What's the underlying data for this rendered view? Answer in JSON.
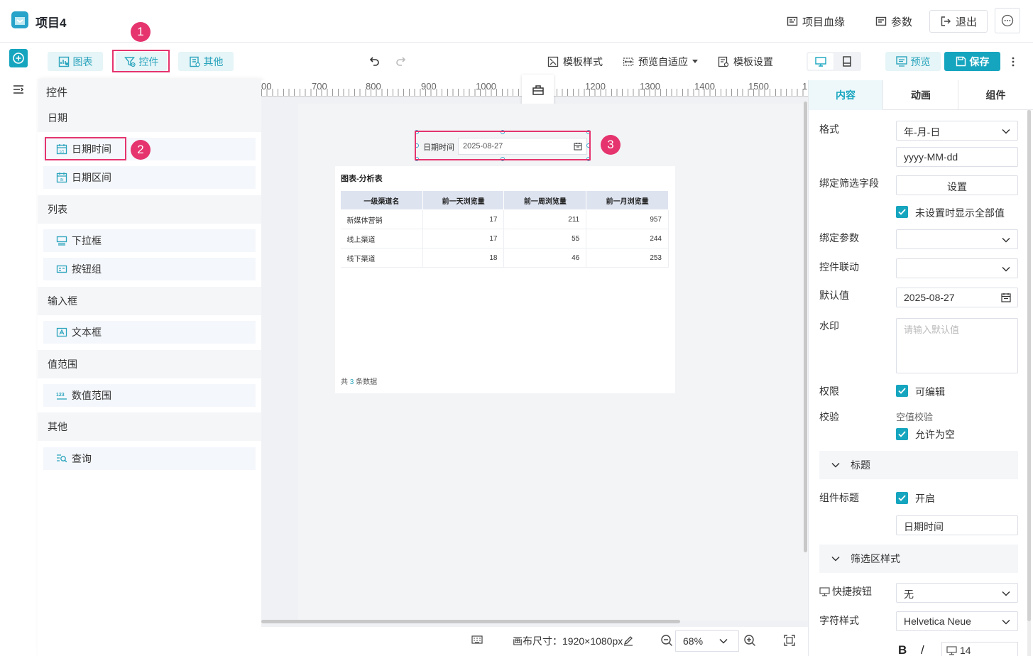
{
  "header": {
    "project_title": "项目4",
    "lineage_label": "项目血缘",
    "params_label": "参数",
    "exit_label": "退出"
  },
  "toolbar": {
    "tabs": [
      {
        "label": "图表"
      },
      {
        "label": "控件"
      },
      {
        "label": "其他"
      }
    ],
    "template_style_label": "模板样式",
    "preview_fit_label": "预览自适应",
    "template_settings_label": "模板设置",
    "preview_label": "预览",
    "save_label": "保存"
  },
  "annotations": {
    "marker_1": "1",
    "marker_2": "2",
    "marker_3": "3",
    "highlight_color": "#e5346e"
  },
  "left_panel": {
    "title": "控件",
    "sections": [
      {
        "title": "日期",
        "items": [
          "日期时间",
          "日期区间"
        ]
      },
      {
        "title": "列表",
        "items": [
          "下拉框",
          "按钮组"
        ]
      },
      {
        "title": "输入框",
        "items": [
          "文本框"
        ]
      },
      {
        "title": "值范围",
        "items": [
          "数值范围"
        ]
      },
      {
        "title": "其他",
        "items": [
          "查询"
        ]
      }
    ]
  },
  "canvas": {
    "ruler_labels": [
      "00",
      "700",
      "800",
      "900",
      "1000",
      "1200",
      "1300",
      "1400",
      "1500",
      "1"
    ],
    "date_widget": {
      "label": "日期时间",
      "value": "2025-08-27"
    },
    "table_card": {
      "title": "图表-分析表",
      "columns": [
        "一级渠道名",
        "前一天浏览量",
        "前一周浏览量",
        "前一月浏览量"
      ],
      "rows": [
        [
          "新媒体营销",
          "17",
          "211",
          "957"
        ],
        [
          "线上渠道",
          "17",
          "55",
          "244"
        ],
        [
          "线下渠道",
          "18",
          "46",
          "253"
        ]
      ],
      "footer_prefix": "共",
      "footer_count": "3",
      "footer_suffix": "条数据"
    }
  },
  "status_bar": {
    "canvas_size": "画布尺寸：1920×1080px",
    "zoom": "68%"
  },
  "right_panel": {
    "tabs": [
      "内容",
      "动画",
      "组件"
    ],
    "format_label": "格式",
    "format_value": "年-月-日",
    "format_pattern": "yyyy-MM-dd",
    "bind_filter_label": "绑定筛选字段",
    "bind_filter_button": "设置",
    "show_all_label": "未设置时显示全部值",
    "bind_param_label": "绑定参数",
    "linkage_label": "控件联动",
    "default_label": "默认值",
    "default_value": "2025-08-27",
    "watermark_label": "水印",
    "watermark_placeholder": "请输入默认值",
    "permission_label": "权限",
    "editable_label": "可编辑",
    "validation_label": "校验",
    "null_check_label": "空值校验",
    "allow_empty_label": "允许为空",
    "title_section": "标题",
    "comp_title_label": "组件标题",
    "comp_title_on": "开启",
    "comp_title_value": "日期时间",
    "filter_style_section": "筛选区样式",
    "quick_btn_label": "快捷按钮",
    "quick_btn_value": "无",
    "font_style_label": "字符样式",
    "font_value": "Helvetica Neue",
    "bold_label": "B",
    "italic_label": "/",
    "font_size_value": "14"
  },
  "colors": {
    "accent": "#16a5bf",
    "accent_light": "#e6f5f7",
    "table_header": "#dde3ef"
  }
}
